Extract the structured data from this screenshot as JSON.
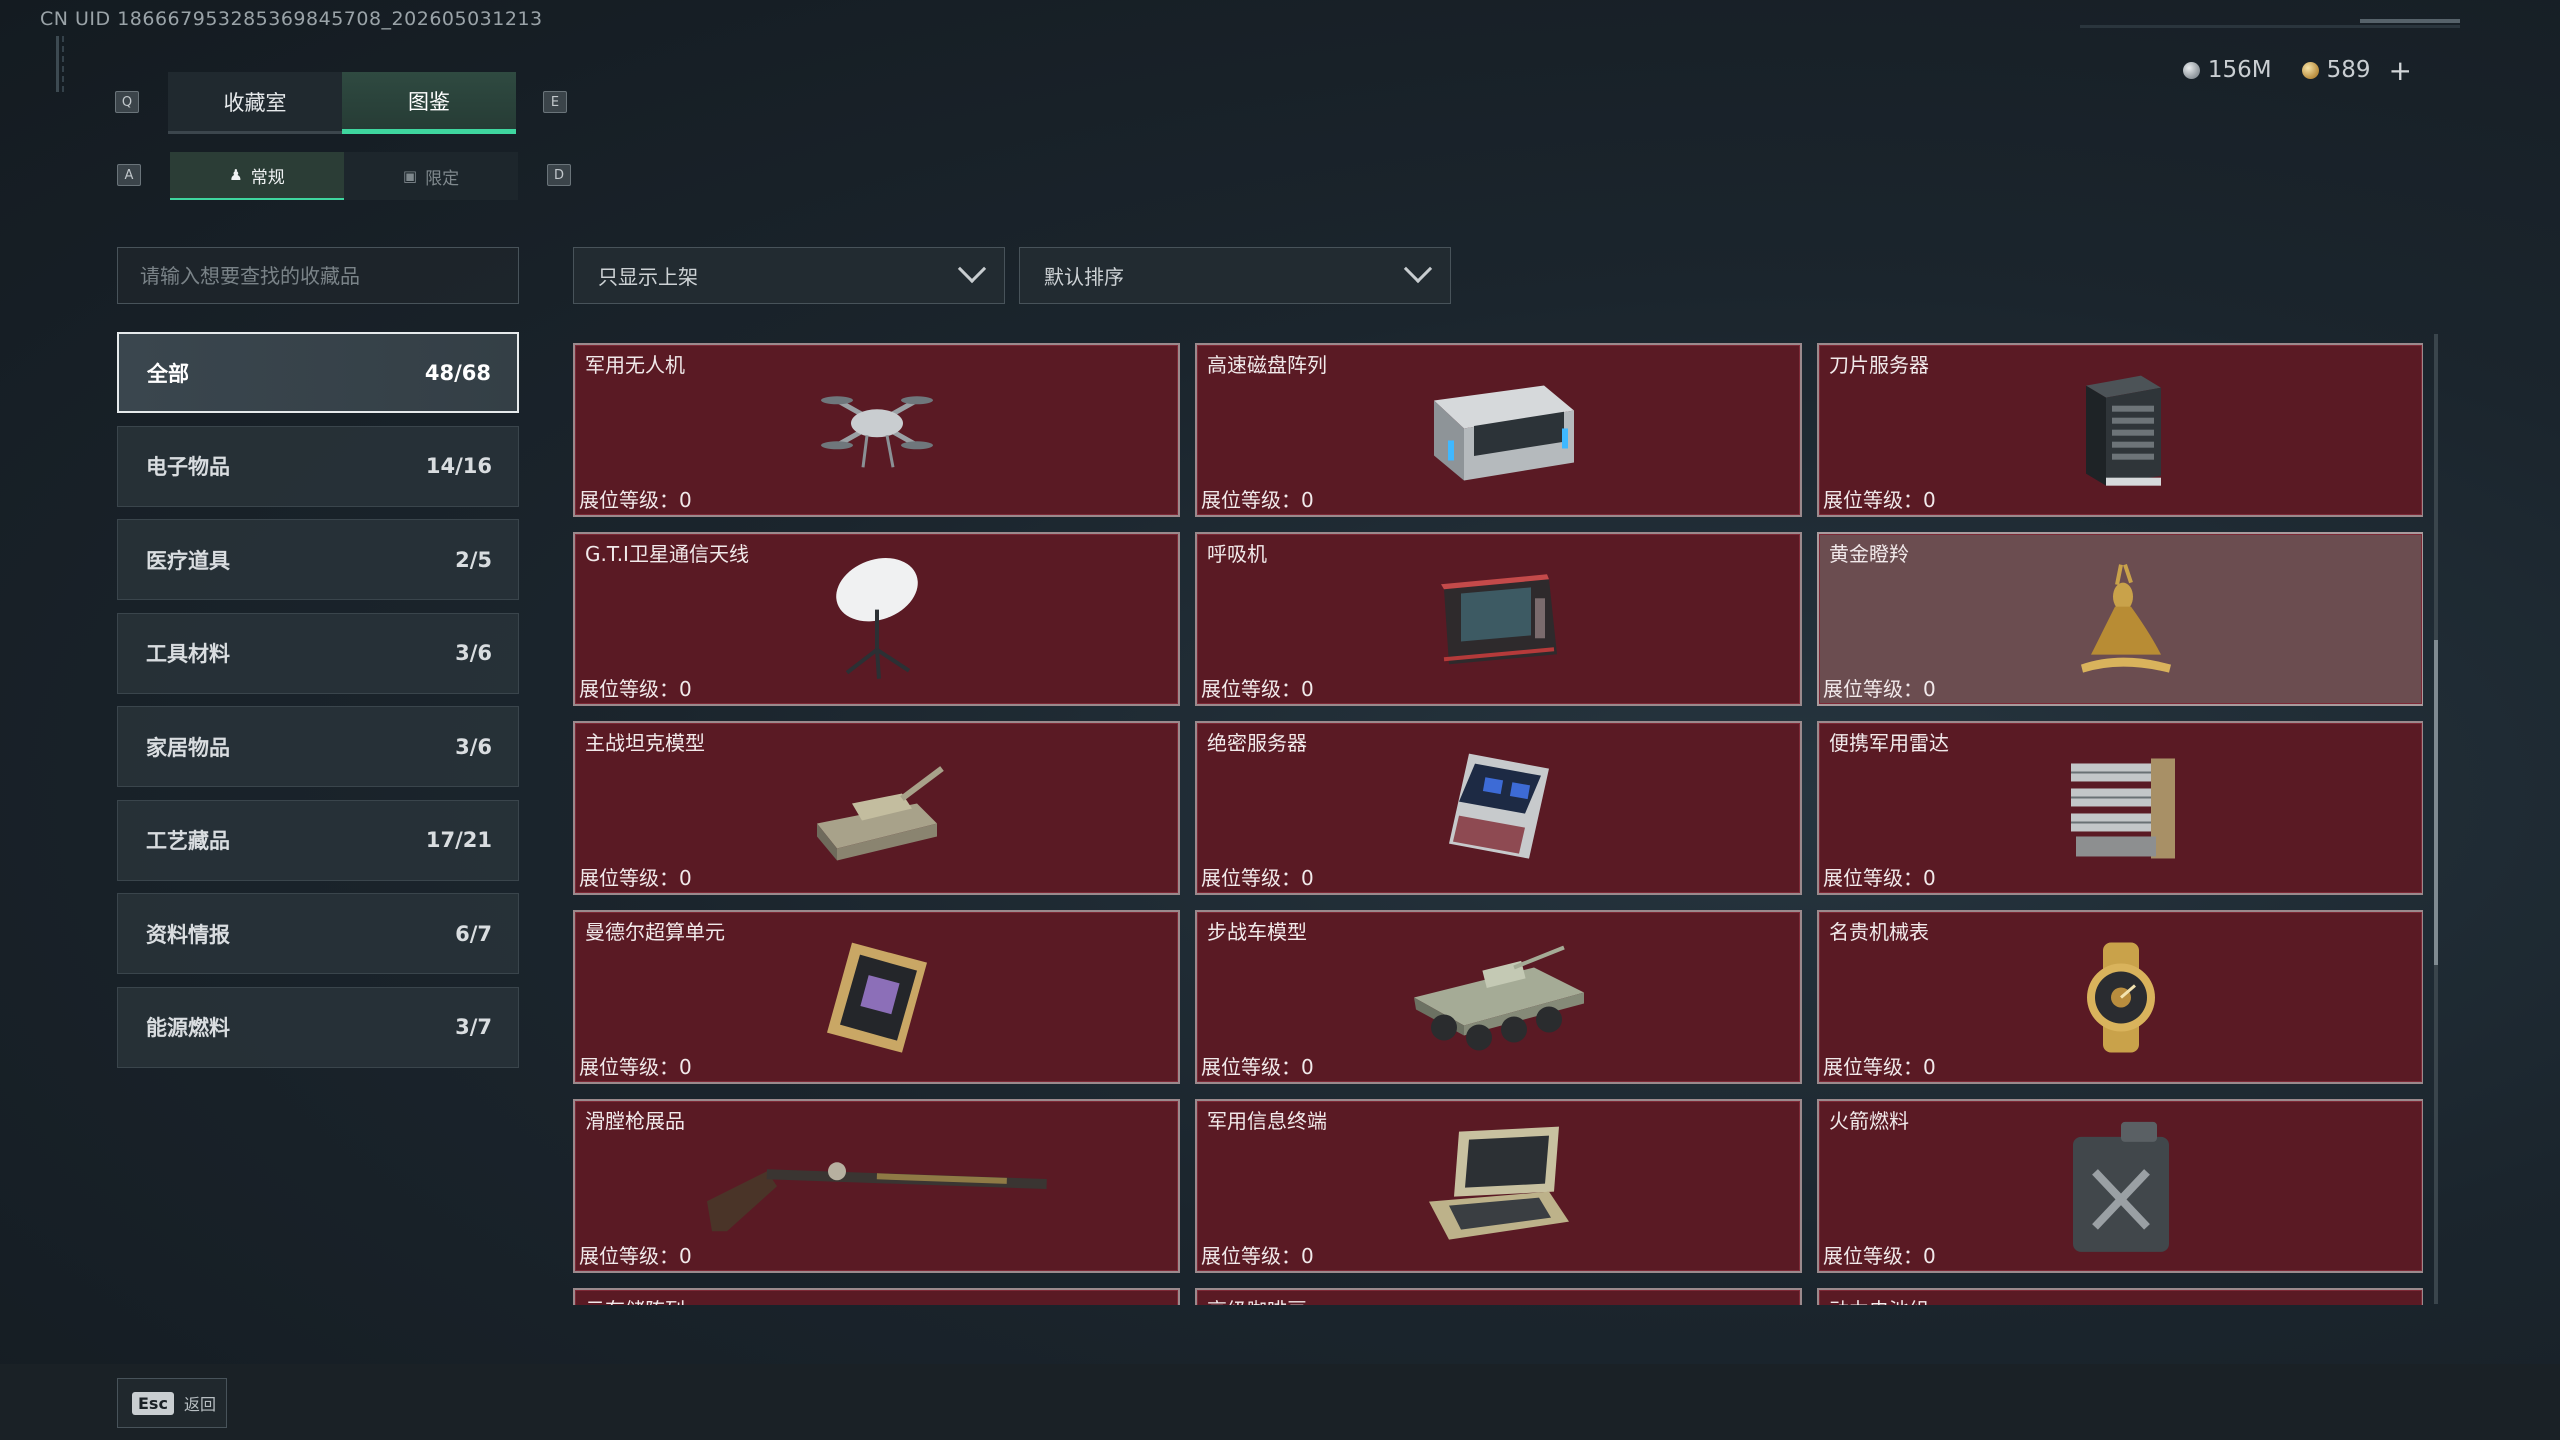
{
  "uid_text": "CN UID 1866679532853698457​08_202605031213",
  "currency": {
    "silver": "156M",
    "gold": "589",
    "plus": "+"
  },
  "keys": {
    "q": "Q",
    "e": "E",
    "a": "A",
    "d": "D"
  },
  "tabs": [
    {
      "label": "收藏室",
      "active": false
    },
    {
      "label": "图鉴",
      "active": true
    }
  ],
  "subtabs": [
    {
      "label": "常规",
      "icon": "person-icon",
      "active": true
    },
    {
      "label": "限定",
      "icon": "image-icon",
      "active": false
    }
  ],
  "search": {
    "placeholder": "请输入想要查找的收藏品"
  },
  "filters": {
    "display": "只显示上架",
    "sort": "默认排序"
  },
  "categories": [
    {
      "label": "全部",
      "count": "48/68",
      "active": true
    },
    {
      "label": "电子物品",
      "count": "14/16"
    },
    {
      "label": "医疗道具",
      "count": "2/5"
    },
    {
      "label": "工具材料",
      "count": "3/6"
    },
    {
      "label": "家居物品",
      "count": "3/6"
    },
    {
      "label": "工艺藏品",
      "count": "17/21"
    },
    {
      "label": "资料情报",
      "count": "6/7"
    },
    {
      "label": "能源燃料",
      "count": "3/7"
    }
  ],
  "level_label": "展位等级：0",
  "items": [
    {
      "name": "军用无人机",
      "icon": "drone-icon"
    },
    {
      "name": "高速磁盘阵列",
      "icon": "disk-array-icon"
    },
    {
      "name": "刀片服务器",
      "icon": "blade-server-icon"
    },
    {
      "name": "G.T.I卫星通信天线",
      "icon": "satellite-dish-icon"
    },
    {
      "name": "呼吸机",
      "icon": "ventilator-icon"
    },
    {
      "name": "黄金瞪羚",
      "icon": "golden-gazelle-icon",
      "gold": true
    },
    {
      "name": "主战坦克模型",
      "icon": "tank-model-icon"
    },
    {
      "name": "绝密服务器",
      "icon": "secret-server-icon"
    },
    {
      "name": "便携军用雷达",
      "icon": "portable-radar-icon"
    },
    {
      "name": "曼德尔超算单元",
      "icon": "supercomputer-unit-icon"
    },
    {
      "name": "步战车模型",
      "icon": "ifv-model-icon"
    },
    {
      "name": "名贵机械表",
      "icon": "luxury-watch-icon"
    },
    {
      "name": "滑膛枪展品",
      "icon": "musket-icon"
    },
    {
      "name": "军用信息终端",
      "icon": "info-terminal-icon"
    },
    {
      "name": "火箭燃料",
      "icon": "rocket-fuel-icon"
    }
  ],
  "partial_items": [
    {
      "name": "云存储阵列"
    },
    {
      "name": "高级咖啡豆"
    },
    {
      "name": "动力电池组"
    }
  ],
  "footer": {
    "esc_key": "Esc",
    "back_label": "返回"
  }
}
